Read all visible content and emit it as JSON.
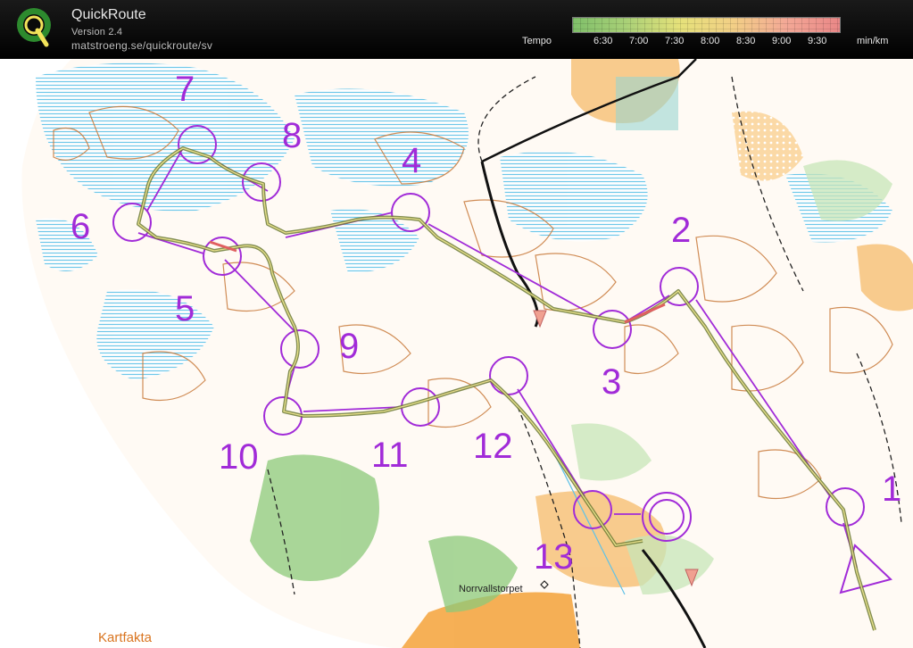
{
  "app": {
    "title": "QuickRoute",
    "version": "Version 2.4",
    "url": "matstroeng.se/quickroute/sv"
  },
  "legend": {
    "label": "Tempo",
    "ticks": [
      "6:30",
      "7:00",
      "7:30",
      "8:00",
      "8:30",
      "9:00",
      "9:30"
    ],
    "unit": "min/km",
    "colors": [
      "#7fbf6a",
      "#a9d077",
      "#e5e17a",
      "#f2cf86",
      "#f3a896",
      "#e98787"
    ]
  },
  "map": {
    "controls": [
      "1",
      "2",
      "3",
      "4",
      "5",
      "6",
      "7",
      "8",
      "9",
      "10",
      "11",
      "12",
      "13"
    ],
    "place_name": "Norrvallstorpet",
    "maker": "Kartfakta",
    "colors": {
      "course": "#a12bd8",
      "route": "#5a7d3a",
      "water": "#5fc2e8",
      "contour": "#c8793a",
      "open": "#f7b44a",
      "forest": "#8cc97a"
    }
  }
}
